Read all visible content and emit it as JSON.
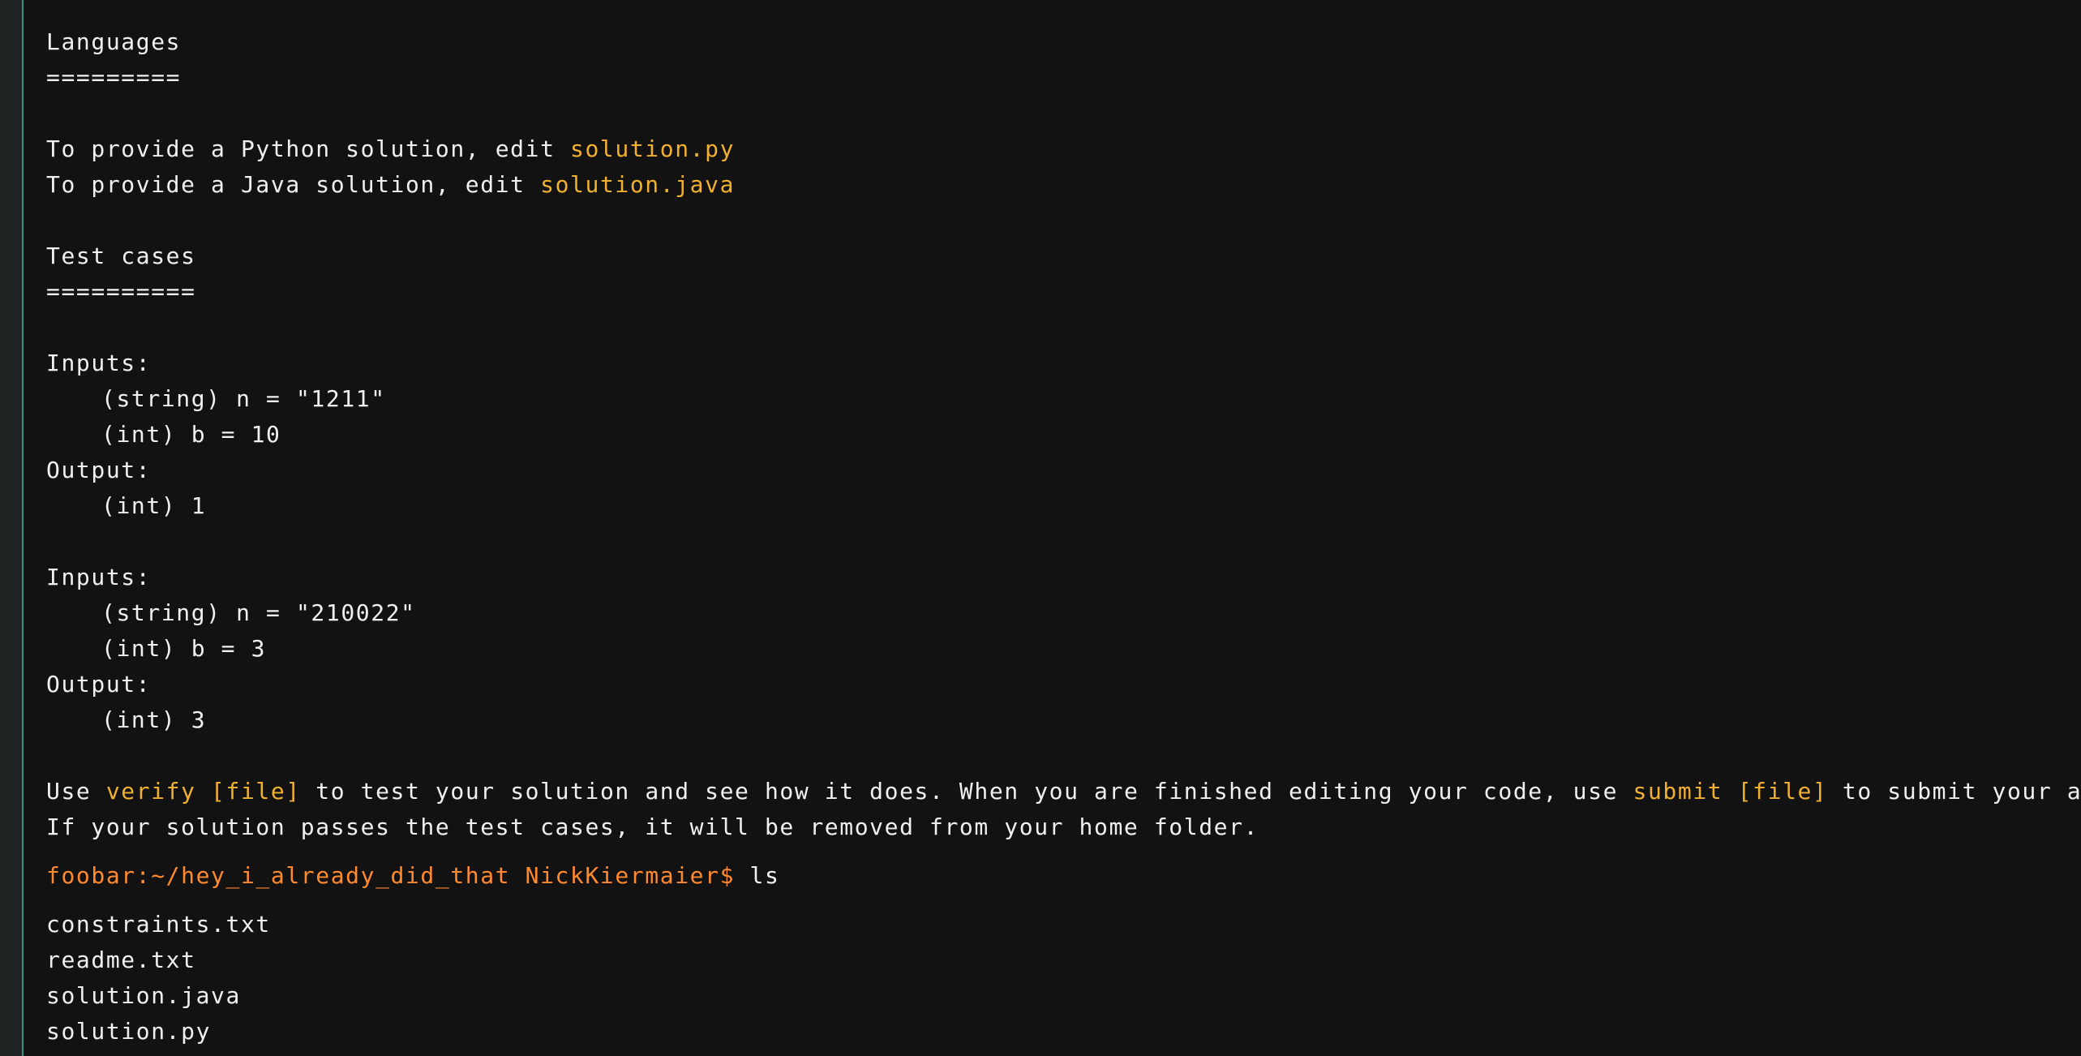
{
  "languages": {
    "heading": "Languages",
    "underline": "=========",
    "python_prefix": "To provide a Python solution, edit ",
    "python_file": "solution.py",
    "java_prefix": "To provide a Java solution, edit ",
    "java_file": "solution.java"
  },
  "test_cases": {
    "heading": "Test cases",
    "underline": "==========",
    "cases": [
      {
        "inputs_label": "Inputs:",
        "input_n": "(string) n = \"1211\"",
        "input_b": "(int) b = 10",
        "output_label": "Output:",
        "output": "(int) 1"
      },
      {
        "inputs_label": "Inputs:",
        "input_n": "(string) n = \"210022\"",
        "input_b": "(int) b = 3",
        "output_label": "Output:",
        "output": "(int) 3"
      }
    ]
  },
  "instructions": {
    "use": "Use ",
    "verify_cmd": "verify [file]",
    "middle": " to test your solution and see how it does. When you are finished editing your code, use ",
    "submit_cmd": "submit [file]",
    "end": " to submit your answer.",
    "line2": "If your solution passes the test cases, it will be removed from your home folder."
  },
  "shell": {
    "prompt": "foobar:~/hey_i_already_did_that NickKiermaier$",
    "command": " ls",
    "files": [
      "constraints.txt",
      "readme.txt",
      "solution.java",
      "solution.py"
    ]
  },
  "colors": {
    "background": "#121212",
    "text": "#f0f0f0",
    "highlight": "#f0b030",
    "prompt": "#ff8a30",
    "gutter_border": "#3a8f86"
  }
}
